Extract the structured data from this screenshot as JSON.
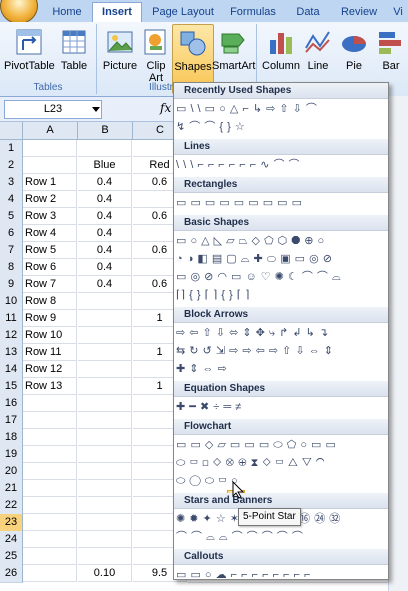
{
  "ribbon": {
    "tabs": [
      {
        "label": "Home"
      },
      {
        "label": "Insert"
      },
      {
        "label": "Page Layout"
      },
      {
        "label": "Formulas"
      },
      {
        "label": "Data"
      },
      {
        "label": "Review"
      },
      {
        "label": "Vi"
      }
    ],
    "buttons": {
      "pivottable": "PivotTable",
      "table": "Table",
      "picture": "Picture",
      "clipart1": "Clip",
      "clipart2": "Art",
      "shapes": "Shapes",
      "smartart": "SmartArt",
      "column": "Column",
      "line": "Line",
      "pie": "Pie",
      "bar": "Bar"
    },
    "groups": {
      "tables": "Tables",
      "illustrations": "Illustr"
    }
  },
  "formula_bar": {
    "name_box": "L23",
    "fx": "fx"
  },
  "sheet": {
    "columns": [
      "A",
      "B",
      "C"
    ],
    "rows": [
      {
        "n": "1",
        "a": "",
        "b": "",
        "c": ""
      },
      {
        "n": "2",
        "a": "",
        "b": "Blue",
        "c": "Red"
      },
      {
        "n": "3",
        "a": "Row 1",
        "b": "0.4",
        "c": "0.6"
      },
      {
        "n": "4",
        "a": "Row 2",
        "b": "0.4",
        "c": ""
      },
      {
        "n": "5",
        "a": "Row 3",
        "b": "0.4",
        "c": "0.6"
      },
      {
        "n": "6",
        "a": "Row 4",
        "b": "0.4",
        "c": ""
      },
      {
        "n": "7",
        "a": "Row 5",
        "b": "0.4",
        "c": "0.6"
      },
      {
        "n": "8",
        "a": "Row 6",
        "b": "0.4",
        "c": ""
      },
      {
        "n": "9",
        "a": "Row 7",
        "b": "0.4",
        "c": "0.6"
      },
      {
        "n": "10",
        "a": "Row 8",
        "b": "",
        "c": ""
      },
      {
        "n": "11",
        "a": "Row 9",
        "b": "",
        "c": "1"
      },
      {
        "n": "12",
        "a": "Row 10",
        "b": "",
        "c": ""
      },
      {
        "n": "13",
        "a": "Row 11",
        "b": "",
        "c": "1"
      },
      {
        "n": "14",
        "a": "Row 12",
        "b": "",
        "c": ""
      },
      {
        "n": "15",
        "a": "Row 13",
        "b": "",
        "c": "1"
      },
      {
        "n": "16",
        "a": "",
        "b": "",
        "c": ""
      },
      {
        "n": "17",
        "a": "",
        "b": "",
        "c": ""
      },
      {
        "n": "18",
        "a": "",
        "b": "",
        "c": ""
      },
      {
        "n": "19",
        "a": "",
        "b": "",
        "c": ""
      },
      {
        "n": "20",
        "a": "",
        "b": "",
        "c": ""
      },
      {
        "n": "21",
        "a": "",
        "b": "",
        "c": ""
      },
      {
        "n": "22",
        "a": "",
        "b": "",
        "c": ""
      },
      {
        "n": "23",
        "a": "",
        "b": "",
        "c": ""
      },
      {
        "n": "24",
        "a": "",
        "b": "",
        "c": ""
      },
      {
        "n": "25",
        "a": "",
        "b": "",
        "c": ""
      },
      {
        "n": "26",
        "a": "",
        "b": "0.10",
        "c": "9.5"
      }
    ],
    "selected_row": "23"
  },
  "shapes_menu": {
    "sections": [
      {
        "title": "Recently Used Shapes",
        "rows": [
          "▭ \\ \\ ▭ ○ △ ⌐ ↳ ⇨ ⇧ ⇩ ⌒",
          "↯ ⌒ ⌒ { } ☆"
        ]
      },
      {
        "title": "Lines",
        "rows": [
          "\\ \\ \\ ⌐ ⌐ ⌐ ⌐ ⌐ ⌐ ∿ ⌒ ⌒"
        ]
      },
      {
        "title": "Rectangles",
        "rows": [
          "▭ ▭ ▭ ▭ ▭ ▭ ▭ ▭ ▭"
        ]
      },
      {
        "title": "Basic Shapes",
        "rows": [
          "▭ ○ △ ◺ ▱ ⏢ ◇ ⬠ ⬡ ⯃ ⊕ ○",
          "◔ ◑ ◧ ▤ ▢ ⌓ ✚ ⬭ ▣ ▭ ◎ ⊘",
          "▭ ◎ ⊘ ◠ ▭ ☺ ♡ ✺ ☾ ⌒ ⌒ ⌓",
          "⌈⌉ { } ⌈ ⌉ { } ⌈ ⌉"
        ]
      },
      {
        "title": "Block Arrows",
        "rows": [
          "⇨ ⇦ ⇧ ⇩ ⬄ ⇕ ✥ ⤷ ↱ ↲ ↳ ↴",
          "⇆ ↻ ↺ ⇲ ⇨ ⇨ ⇦ ⇨ ⇧ ⇩ ⇔ ⇕",
          "✚ ⇕ ⇔ ⇨"
        ]
      },
      {
        "title": "Equation Shapes",
        "rows": [
          "✚ ━ ✖ ÷ ═ ≠"
        ]
      },
      {
        "title": "Flowchart",
        "rows": [
          "▭ ▭ ◇ ▱ ▭ ▭ ▭ ⬭ ⬠ ○ ▭ ▭",
          "⬭ ▭ ◻ ◇ ⊗ ⊕ ⧗ ◇ ▭ △ ▽ ◠",
          "⬭ ◯ ⬭ ▭ ○"
        ]
      },
      {
        "title": "Stars and Banners",
        "rows": [
          "✺ ✹ ✦ ☆ ✶ ✷ ⑧ ⑩ ⑫ ⑯ ㉔ ㉜",
          "⌒ ⌒ ⌓ ⌓ ⌒ ⌒ ⌒ ⌒ ⌒"
        ]
      },
      {
        "title": "Callouts",
        "rows": [
          "▭ ▭ ○ ☁ ⌐ ⌐ ⌐ ⌐ ⌐ ⌐ ⌐ ⌐",
          "⌐ ⌐ ⌐ ⌐ ⌐ ⌐ ⌐ ⌐ ⌐"
        ]
      }
    ],
    "tooltip": "5-Point Star"
  }
}
